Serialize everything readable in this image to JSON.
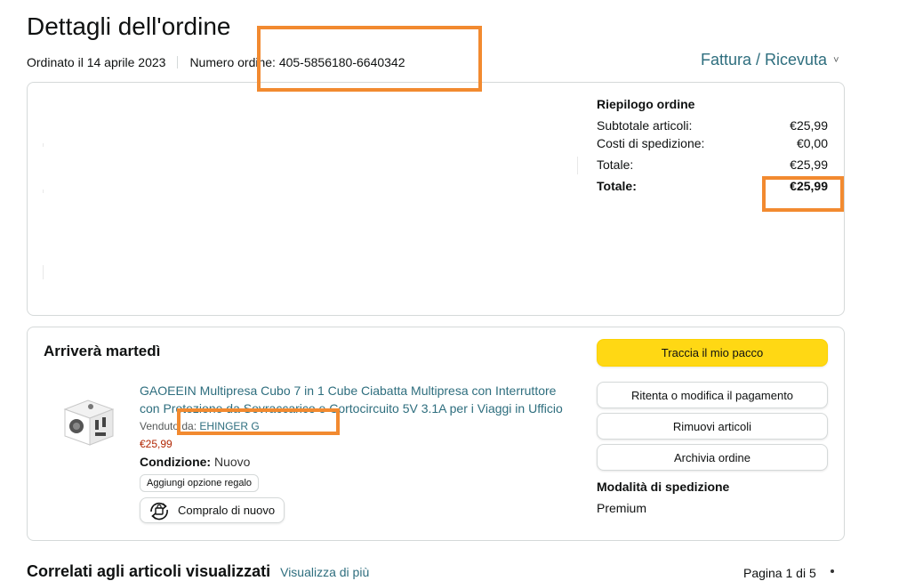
{
  "page": {
    "title": "Dettagli dell'ordine",
    "ordered": "Ordinato il 14 aprile 2023",
    "order_number": "Numero ordine: 405-5856180-6640342",
    "invoice_link": "Fattura / Ricevuta",
    "invoice_chevron": "˅"
  },
  "summary": {
    "heading": "Riepilogo ordine",
    "subtotal_label": "Subtotale articoli:",
    "subtotal_value": "€25,99",
    "shipping_label": "Costi di spedizione:",
    "shipping_value": "€0,00",
    "total_label": "Totale:",
    "total_value": "€25,99",
    "grand_total_label": "Totale:",
    "grand_total_value": "€25,99"
  },
  "shipment": {
    "arrival": "Arriverà martedì",
    "product_title": "GAOEEIN Multipresa Cubo 7 in 1 Cube Ciabatta Multipresa con Interruttore con Protezione da Sovraccarico e Cortocircuito 5V 3.1A per i Viaggi in Ufficio",
    "sold_by_label": "Venduto da:",
    "seller": "EHINGER G",
    "price": "€25,99",
    "condition_label": "Condizione:",
    "condition_value": "Nuovo",
    "gift_button": "Aggiungi opzione regalo",
    "buy_again_button": "Compralo di nuovo",
    "buy_again_icon": "buy-again-icon",
    "product_image": "power-cube-product-image"
  },
  "actions": {
    "track": "Traccia il mio pacco",
    "retry_payment": "Ritenta o modifica il pagamento",
    "remove": "Rimuovi articoli",
    "archive": "Archivia ordine",
    "shipping_method_heading": "Modalità di spedizione",
    "shipping_method_value": "Premium"
  },
  "related": {
    "heading": "Correlati agli articoli visualizzati",
    "see_more": "Visualizza di più",
    "page": "Pagina 1 di 5"
  },
  "colors": {
    "link": "#2e6e7e",
    "primary_button": "#ffd814",
    "price": "#b12704",
    "annotation_box": "#f28a30",
    "border": "#d5d9d9"
  }
}
